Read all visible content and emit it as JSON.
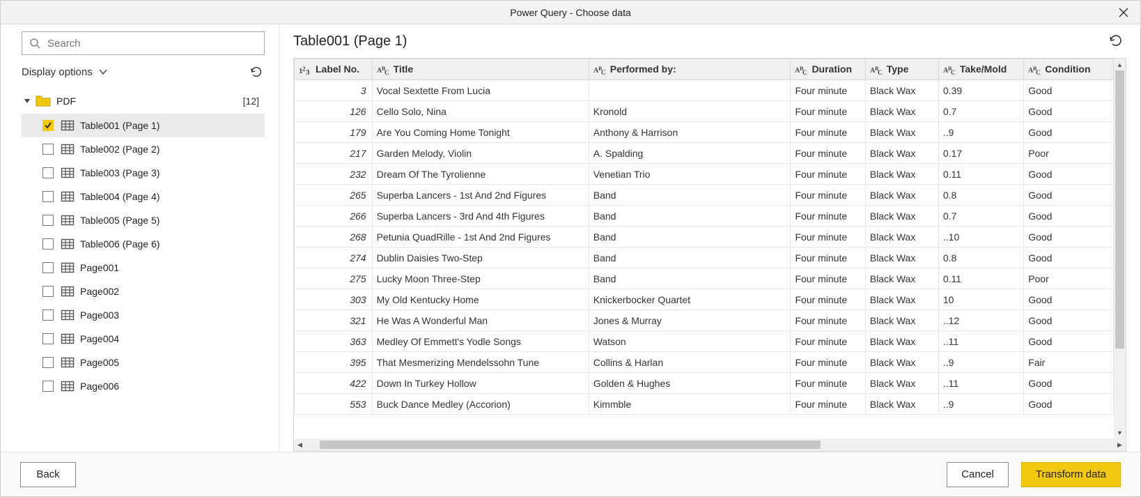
{
  "window": {
    "title": "Power Query - Choose data"
  },
  "sidebar": {
    "search_placeholder": "Search",
    "display_options_label": "Display options",
    "root": {
      "label": "PDF",
      "count": "[12]"
    },
    "items": [
      {
        "label": "Table001 (Page 1)",
        "checked": true,
        "icon": "table"
      },
      {
        "label": "Table002 (Page 2)",
        "checked": false,
        "icon": "table"
      },
      {
        "label": "Table003 (Page 3)",
        "checked": false,
        "icon": "table"
      },
      {
        "label": "Table004 (Page 4)",
        "checked": false,
        "icon": "table"
      },
      {
        "label": "Table005 (Page 5)",
        "checked": false,
        "icon": "table"
      },
      {
        "label": "Table006 (Page 6)",
        "checked": false,
        "icon": "table"
      },
      {
        "label": "Page001",
        "checked": false,
        "icon": "table"
      },
      {
        "label": "Page002",
        "checked": false,
        "icon": "table"
      },
      {
        "label": "Page003",
        "checked": false,
        "icon": "table"
      },
      {
        "label": "Page004",
        "checked": false,
        "icon": "table"
      },
      {
        "label": "Page005",
        "checked": false,
        "icon": "table"
      },
      {
        "label": "Page006",
        "checked": false,
        "icon": "table"
      }
    ]
  },
  "main": {
    "title": "Table001 (Page 1)",
    "columns": [
      {
        "name": "Label No.",
        "type": "number"
      },
      {
        "name": "Title",
        "type": "text"
      },
      {
        "name": "Performed by:",
        "type": "text"
      },
      {
        "name": "Duration",
        "type": "text"
      },
      {
        "name": "Type",
        "type": "text"
      },
      {
        "name": "Take/Mold",
        "type": "text"
      },
      {
        "name": "Condition",
        "type": "text"
      }
    ],
    "rows": [
      {
        "label_no": "3",
        "title": "Vocal Sextette From Lucia",
        "performed_by": "",
        "duration": "Four minute",
        "type": "Black Wax",
        "take": "0.39",
        "condition": "Good"
      },
      {
        "label_no": "126",
        "title": "Cello Solo, Nina",
        "performed_by": "Kronold",
        "duration": "Four minute",
        "type": "Black Wax",
        "take": "0.7",
        "condition": "Good"
      },
      {
        "label_no": "179",
        "title": "Are You Coming Home Tonight",
        "performed_by": "Anthony & Harrison",
        "duration": "Four minute",
        "type": "Black Wax",
        "take": "..9",
        "condition": "Good"
      },
      {
        "label_no": "217",
        "title": "Garden Melody, Violin",
        "performed_by": "A. Spalding",
        "duration": "Four minute",
        "type": "Black Wax",
        "take": "0.17",
        "condition": "Poor"
      },
      {
        "label_no": "232",
        "title": "Dream Of The Tyrolienne",
        "performed_by": "Venetian Trio",
        "duration": "Four minute",
        "type": "Black Wax",
        "take": "0.11",
        "condition": "Good"
      },
      {
        "label_no": "265",
        "title": "Superba Lancers - 1st And 2nd Figures",
        "performed_by": "Band",
        "duration": "Four minute",
        "type": "Black Wax",
        "take": "0.8",
        "condition": "Good"
      },
      {
        "label_no": "266",
        "title": "Superba Lancers - 3rd And 4th Figures",
        "performed_by": "Band",
        "duration": "Four minute",
        "type": "Black Wax",
        "take": "0.7",
        "condition": "Good"
      },
      {
        "label_no": "268",
        "title": "Petunia QuadRille - 1st And 2nd Figures",
        "performed_by": "Band",
        "duration": "Four minute",
        "type": "Black Wax",
        "take": "..10",
        "condition": "Good"
      },
      {
        "label_no": "274",
        "title": "Dublin Daisies Two-Step",
        "performed_by": "Band",
        "duration": "Four minute",
        "type": "Black Wax",
        "take": "0.8",
        "condition": "Good"
      },
      {
        "label_no": "275",
        "title": "Lucky Moon Three-Step",
        "performed_by": "Band",
        "duration": "Four minute",
        "type": "Black Wax",
        "take": "0.11",
        "condition": "Poor"
      },
      {
        "label_no": "303",
        "title": "My Old Kentucky Home",
        "performed_by": "Knickerbocker Quartet",
        "duration": "Four minute",
        "type": "Black Wax",
        "take": "10",
        "condition": "Good"
      },
      {
        "label_no": "321",
        "title": "He Was A Wonderful Man",
        "performed_by": "Jones & Murray",
        "duration": "Four minute",
        "type": "Black Wax",
        "take": "..12",
        "condition": "Good"
      },
      {
        "label_no": "363",
        "title": "Medley Of Emmett's Yodle Songs",
        "performed_by": "Watson",
        "duration": "Four minute",
        "type": "Black Wax",
        "take": "..11",
        "condition": "Good"
      },
      {
        "label_no": "395",
        "title": "That Mesmerizing Mendelssohn Tune",
        "performed_by": "Collins & Harlan",
        "duration": "Four minute",
        "type": "Black Wax",
        "take": "..9",
        "condition": "Fair"
      },
      {
        "label_no": "422",
        "title": "Down In Turkey Hollow",
        "performed_by": "Golden & Hughes",
        "duration": "Four minute",
        "type": "Black Wax",
        "take": "..11",
        "condition": "Good"
      },
      {
        "label_no": "553",
        "title": "Buck Dance Medley (Accorion)",
        "performed_by": "Kimmble",
        "duration": "Four minute",
        "type": "Black Wax",
        "take": "..9",
        "condition": "Good"
      }
    ]
  },
  "footer": {
    "back_label": "Back",
    "cancel_label": "Cancel",
    "transform_label": "Transform data"
  }
}
